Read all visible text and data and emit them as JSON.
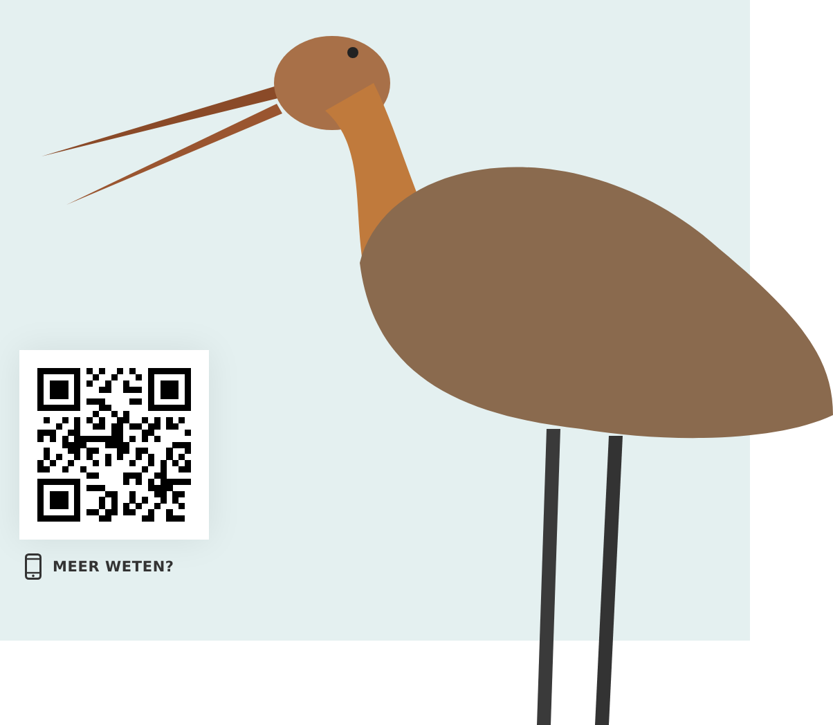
{
  "link": {
    "label": "MEER WETEN?"
  }
}
